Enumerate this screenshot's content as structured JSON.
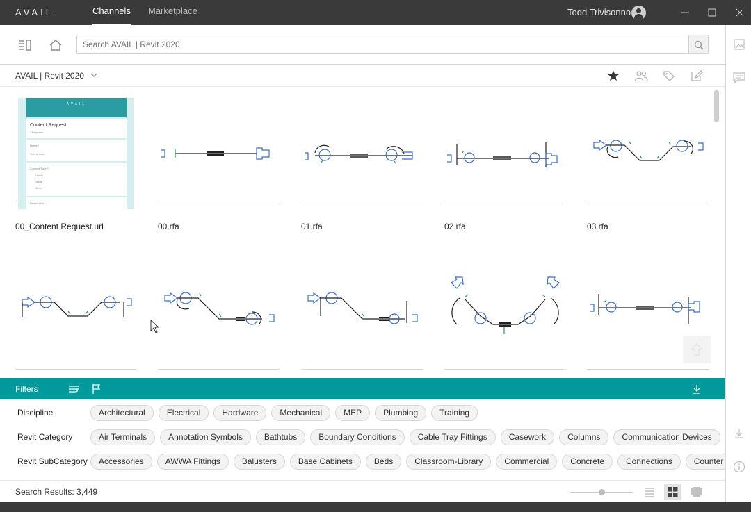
{
  "app": {
    "logo": "AVAIL",
    "nav": [
      {
        "label": "Channels",
        "active": true
      },
      {
        "label": "Marketplace",
        "active": false
      }
    ],
    "user_name": "Todd Trivisonno",
    "window_controls": [
      "minimize-icon",
      "maximize-icon",
      "close-icon"
    ]
  },
  "toolbar": {
    "icons": [
      "panel-toggle-icon",
      "home-icon"
    ],
    "search_placeholder": "Search AVAIL | Revit 2020",
    "search_icon": "search-icon"
  },
  "channel": {
    "name": "AVAIL | Revit 2020",
    "actions": [
      "star-icon",
      "users-icon",
      "tag-icon",
      "edit-icon"
    ]
  },
  "content_request": {
    "banner": "AVAIL",
    "title": "Content Request",
    "required_note": "* Required",
    "name_label": "Name *",
    "name_placeholder": "Your answer",
    "type_label": "Content Type *",
    "options": [
      "Family",
      "Detail",
      "Other"
    ],
    "description_label": "Description *"
  },
  "items": [
    {
      "name": "00_Content Request.url",
      "kind": "form"
    },
    {
      "name": "00.rfa",
      "kind": "fitting"
    },
    {
      "name": "01.rfa",
      "kind": "fitting"
    },
    {
      "name": "02.rfa",
      "kind": "fitting"
    },
    {
      "name": "03.rfa",
      "kind": "fitting"
    },
    {
      "name": "",
      "kind": "fitting"
    },
    {
      "name": "",
      "kind": "fitting"
    },
    {
      "name": "",
      "kind": "fitting"
    },
    {
      "name": "",
      "kind": "fitting"
    },
    {
      "name": "",
      "kind": "fitting"
    }
  ],
  "filters": {
    "title": "Filters",
    "icons": [
      "sort-lines-icon",
      "flag-icon",
      "download-icon"
    ],
    "rows": [
      {
        "label": "Discipline",
        "chips": [
          "Architectural",
          "Electrical",
          "Hardware",
          "Mechanical",
          "MEP",
          "Plumbing",
          "Training"
        ]
      },
      {
        "label": "Revit Category",
        "chips": [
          "Air Terminals",
          "Annotation Symbols",
          "Bathtubs",
          "Boundary Conditions",
          "Cable Tray Fittings",
          "Casework",
          "Columns",
          "Communication Devices",
          "C"
        ]
      },
      {
        "label": "Revit SubCategory",
        "chips": [
          "Accessories",
          "AWWA Fittings",
          "Balusters",
          "Base Cabinets",
          "Beds",
          "Classroom-Library",
          "Commercial",
          "Concrete",
          "Connections",
          "Counter Tops"
        ]
      }
    ]
  },
  "status": {
    "results_text": "Search Results: 3,449",
    "zoom_fraction": 0.5,
    "view_modes": [
      "list-view-icon",
      "grid-view-icon",
      "card-view-icon"
    ],
    "active_view": 1
  },
  "right_panel": {
    "icons": [
      "image-icon",
      "comment-icon",
      "download-icon",
      "info-icon"
    ]
  },
  "colors": {
    "titlebar": "#3a3a3a",
    "filters_accent": "#00999c",
    "fitting_line": "#2a2a2a",
    "fitting_blue": "#3b6fc4",
    "fitting_green": "#2e9a4a"
  }
}
